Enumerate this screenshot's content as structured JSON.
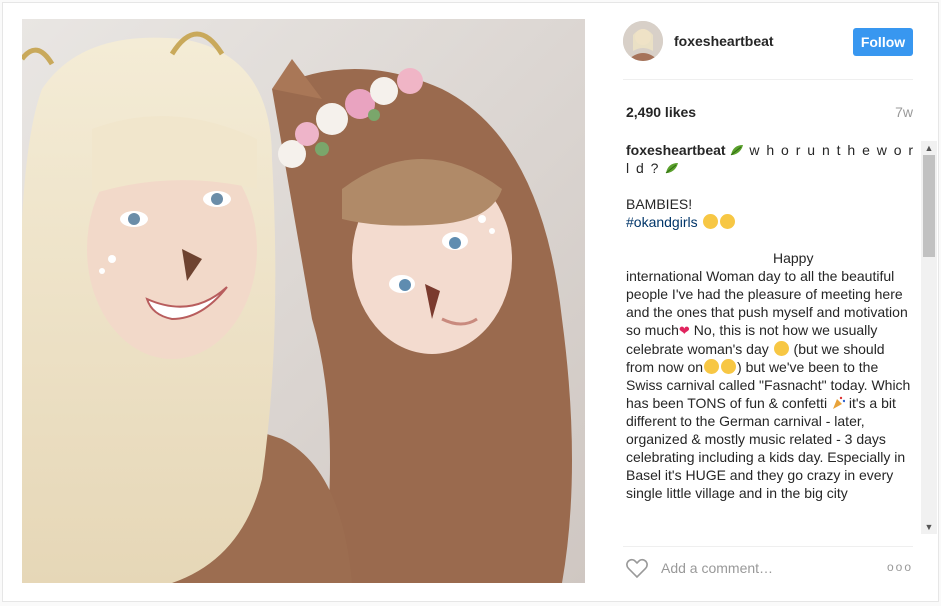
{
  "post": {
    "username": "foxesheartbeat",
    "follow_label": "Follow",
    "likes": "2,490 likes",
    "age": "7w",
    "caption": {
      "user": "foxesheartbeat",
      "title_spaced": "w h o r u n t h e w o r l d ?",
      "line_bambies": "BAMBIES!",
      "hashtag": "#okandgirls",
      "happy": "Happy",
      "body_1": "international Woman day to all the beautiful people I've had the pleasure of meeting here and the ones that push myself and motivation so much",
      "body_2": "No, this is not how we usually celebrate woman's day",
      "body_3": "(but we should from now on",
      "body_4": ") but we've been to the Swiss carnival called \"Fasnacht\" today. Which has been TONS of fun & confetti",
      "body_5": "it's a bit different to the German carnival - later, organized & mostly music related - 3 days celebrating including a kids day. Especially in Basel it's HUGE and they go crazy in every single little village and in the big city"
    },
    "comment_placeholder": "Add a comment…",
    "more_label": "ooo"
  },
  "icons": [
    "leaf-icon",
    "heart-icon",
    "more-options-icon",
    "scroll-up-icon",
    "scroll-down-icon"
  ],
  "colors": {
    "follow_button": "#3897f0",
    "hashtag": "#003569",
    "muted": "#999999"
  }
}
